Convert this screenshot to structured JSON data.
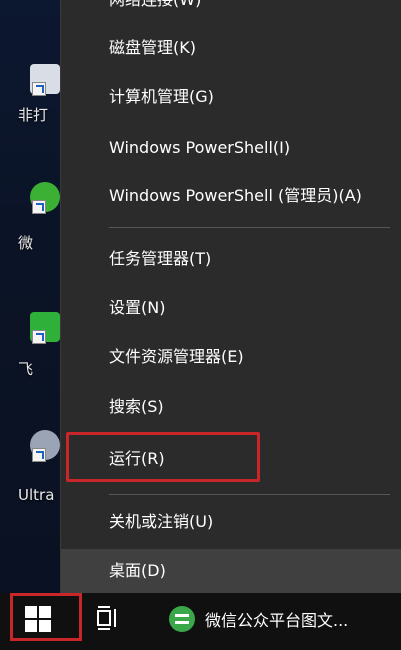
{
  "desktop": {
    "icons": [
      {
        "label": "非打",
        "name": "app-shortcut"
      },
      {
        "label": "微",
        "name": "wechat-shortcut"
      },
      {
        "label": "飞",
        "name": "plane-shortcut"
      },
      {
        "label": "Ultra",
        "name": "ultra-shortcut"
      }
    ]
  },
  "menu": {
    "items": [
      {
        "label": "网络连接(W)"
      },
      {
        "label": "磁盘管理(K)"
      },
      {
        "label": "计算机管理(G)"
      },
      {
        "label": "Windows PowerShell(I)"
      },
      {
        "label": "Windows PowerShell (管理员)(A)"
      },
      {
        "label": "任务管理器(T)"
      },
      {
        "label": "设置(N)"
      },
      {
        "label": "文件资源管理器(E)"
      },
      {
        "label": "搜索(S)"
      },
      {
        "label": "运行(R)"
      },
      {
        "label": "关机或注销(U)"
      },
      {
        "label": "桌面(D)"
      }
    ],
    "highlighted_item": "运行(R)"
  },
  "taskbar": {
    "app_label": "微信公众平台图文..."
  },
  "colors": {
    "menu_bg": "#2b2b2b",
    "hover_bg": "#404040",
    "highlight_border": "#c9262a",
    "taskbar_bg": "#101010"
  }
}
